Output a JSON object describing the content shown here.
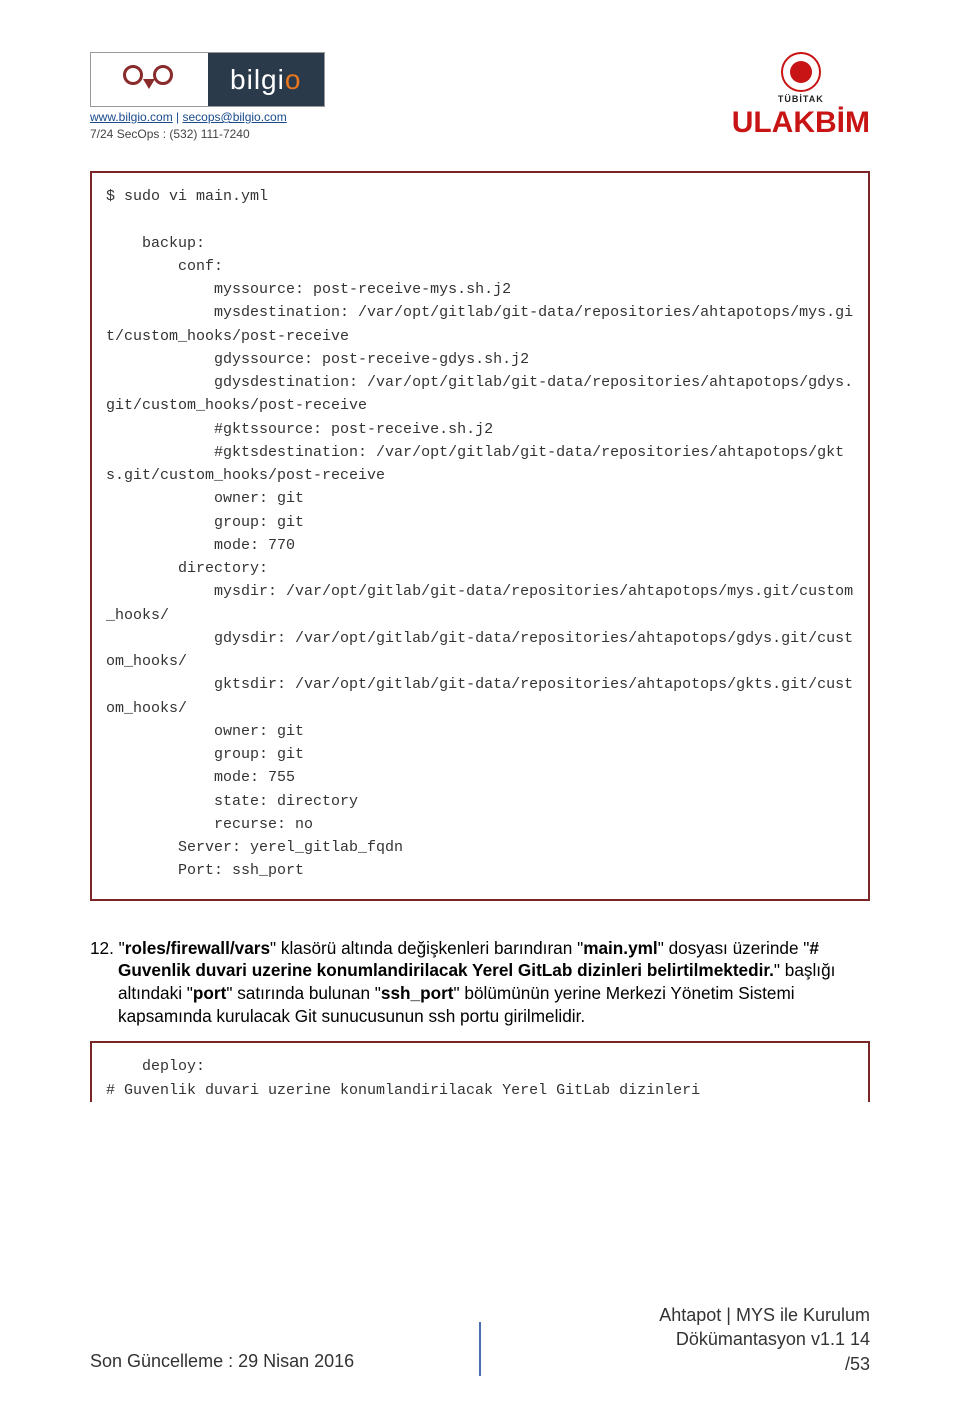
{
  "header": {
    "brand_left": "bilgi",
    "brand_right_o": "o",
    "site": "www.bilgio.com",
    "sep": " | ",
    "email": "secops@bilgio.com",
    "phone": "7/24 SecOps : (532) 111-7240",
    "tubitak_label": "TÜBİTAK",
    "ulakbim": "ULAKBİM"
  },
  "code1": "$ sudo vi main.yml\n\n    backup:\n        conf:\n            myssource: post-receive-mys.sh.j2\n            mysdestination: /var/opt/gitlab/git-data/repositories/ahtapotops/mys.git/custom_hooks/post-receive\n            gdyssource: post-receive-gdys.sh.j2\n            gdysdestination: /var/opt/gitlab/git-data/repositories/ahtapotops/gdys.git/custom_hooks/post-receive\n            #gktssource: post-receive.sh.j2\n            #gktsdestination: /var/opt/gitlab/git-data/repositories/ahtapotops/gkts.git/custom_hooks/post-receive\n            owner: git\n            group: git\n            mode: 770\n        directory:\n            mysdir: /var/opt/gitlab/git-data/repositories/ahtapotops/mys.git/custom_hooks/\n            gdysdir: /var/opt/gitlab/git-data/repositories/ahtapotops/gdys.git/custom_hooks/\n            gktsdir: /var/opt/gitlab/git-data/repositories/ahtapotops/gkts.git/custom_hooks/\n            owner: git\n            group: git\n            mode: 755\n            state: directory\n            recurse: no\n        Server: yerel_gitlab_fqdn\n        Port: ssh_port",
  "paragraph": {
    "num": "12. ",
    "t1": "\"",
    "b1": "roles/firewall/vars",
    "t2": "\" klasörü altında değişkenleri barındıran \"",
    "b2": "main.yml",
    "t3": "\" dosyası üzerinde \"",
    "b3": "# Guvenlik duvari uzerine konumlandirilacak Yerel GitLab dizinleri belirtilmektedir.",
    "t4": "\" başlığı altındaki \"",
    "b4": "port",
    "t5": "\" satırında bulunan \"",
    "b5": "ssh_port",
    "t6": "\" bölümünün yerine Merkezi Yönetim Sistemi kapsamında kurulacak Git sunucusunun ssh portu girilmelidir."
  },
  "code2": "    deploy:\n# Guvenlik duvari uzerine konumlandirilacak Yerel GitLab dizinleri",
  "footer": {
    "left": "Son Güncelleme : 29 Nisan 2016",
    "right1": "Ahtapot | MYS ile Kurulum",
    "right2": "Dökümantasyon v1.1 14",
    "right3": "/53"
  }
}
